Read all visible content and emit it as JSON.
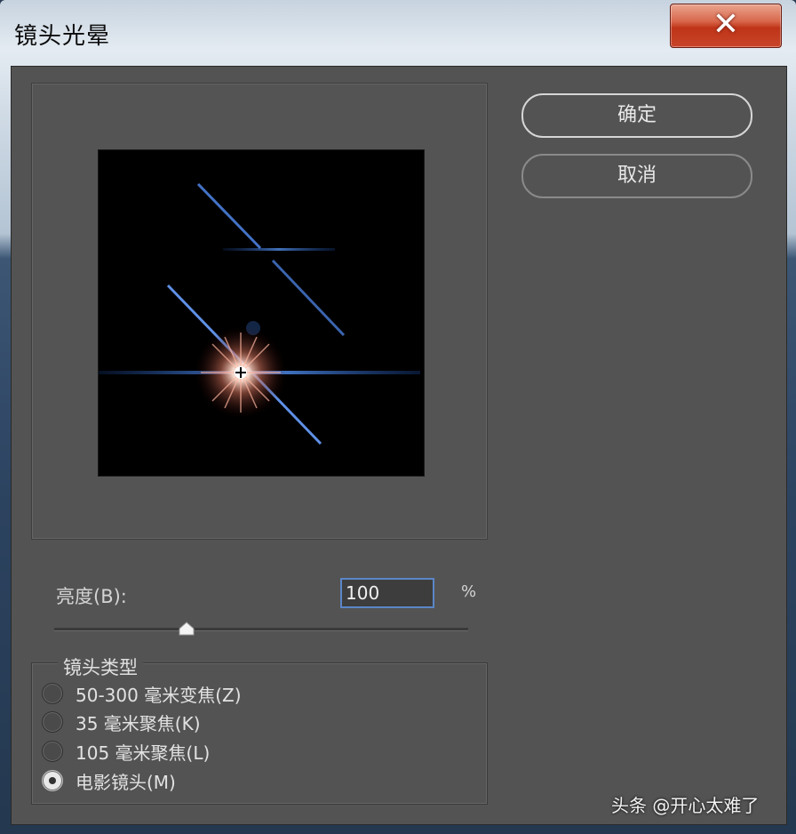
{
  "window": {
    "title": "镜头光晕",
    "close_label": "✕"
  },
  "buttons": {
    "ok": "确定",
    "cancel": "取消"
  },
  "brightness": {
    "label": "亮度(B):",
    "value": "100",
    "unit": "%",
    "slider_fraction": 0.32
  },
  "lens_type": {
    "legend": "镜头类型",
    "options": [
      {
        "label": "50-300 毫米变焦(Z)",
        "checked": false
      },
      {
        "label": "35 毫米聚焦(K)",
        "checked": false
      },
      {
        "label": "105 毫米聚焦(L)",
        "checked": false
      },
      {
        "label": "电影镜头(M)",
        "checked": true
      }
    ]
  },
  "watermark": "头条 @开心太难了",
  "colors": {
    "dialog_bg": "#535353",
    "accent_focus": "#5b86c7",
    "close_red": "#c8452a",
    "flare_blue": "#4f8cff"
  }
}
